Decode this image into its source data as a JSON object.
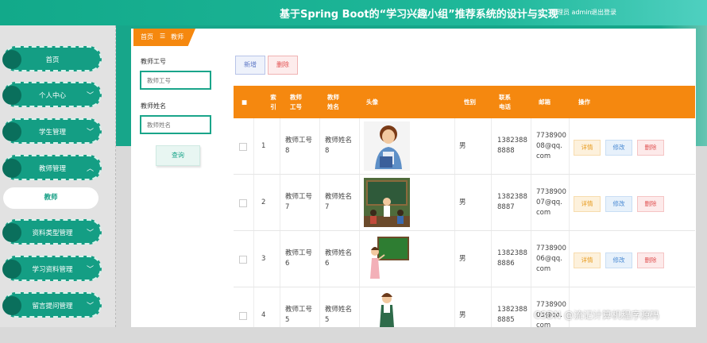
{
  "header": {
    "title": "基于Spring Boot的“学习兴趣小组”推荐系统的设计与实现",
    "admin_text": "管理员 admin",
    "logout_text": "退出登录"
  },
  "sidebar": {
    "items": [
      {
        "label": "首页"
      },
      {
        "label": "个人中心"
      },
      {
        "label": "学生管理"
      },
      {
        "label": "教师管理"
      },
      {
        "label": "资料类型管理"
      },
      {
        "label": "学习资料管理"
      },
      {
        "label": "留言提问管理"
      }
    ],
    "submenu_label": "教师"
  },
  "breadcrumb": {
    "home": "首页",
    "sep": "☰",
    "current": "教师"
  },
  "filter": {
    "id_label": "教师工号",
    "id_placeholder": "教师工号",
    "name_label": "教师姓名",
    "name_placeholder": "教师姓名",
    "query_button": "查询"
  },
  "toolbar": {
    "add_label": "新增",
    "delete_label": "删除"
  },
  "table": {
    "headers": {
      "index": [
        "索",
        "引"
      ],
      "teacher_id": [
        "教师",
        "工号"
      ],
      "teacher_name": [
        "教师",
        "姓名"
      ],
      "avatar": "头像",
      "gender": "性别",
      "phone": [
        "联系",
        "电话"
      ],
      "email": "邮箱",
      "actions": "操作"
    },
    "rows": [
      {
        "index": "1",
        "tid": [
          "教师工号",
          "8"
        ],
        "tname": [
          "教师姓名",
          "8"
        ],
        "gender": "男",
        "phone": [
          "1382388",
          "8888"
        ],
        "email": [
          "7738900",
          "08@qq.",
          "com"
        ]
      },
      {
        "index": "2",
        "tid": [
          "教师工号",
          "7"
        ],
        "tname": [
          "教师姓名",
          "7"
        ],
        "gender": "男",
        "phone": [
          "1382388",
          "8887"
        ],
        "email": [
          "7738900",
          "07@qq.",
          "com"
        ]
      },
      {
        "index": "3",
        "tid": [
          "教师工号",
          "6"
        ],
        "tname": [
          "教师姓名",
          "6"
        ],
        "gender": "男",
        "phone": [
          "1382388",
          "8886"
        ],
        "email": [
          "7738900",
          "06@qq.",
          "com"
        ]
      },
      {
        "index": "4",
        "tid": [
          "教师工号",
          "5"
        ],
        "tname": [
          "教师姓名",
          "5"
        ],
        "gender": "男",
        "phone": [
          "1382388",
          "8885"
        ],
        "email": [
          "7738900",
          "05@qq.",
          "com"
        ]
      }
    ],
    "row_actions": {
      "detail": "详情",
      "edit": "修改",
      "delete": "删除"
    }
  },
  "watermark": "CSDN @流记计算机程序源码",
  "colors": {
    "primary": "#149e84",
    "accent": "#f5880f"
  }
}
